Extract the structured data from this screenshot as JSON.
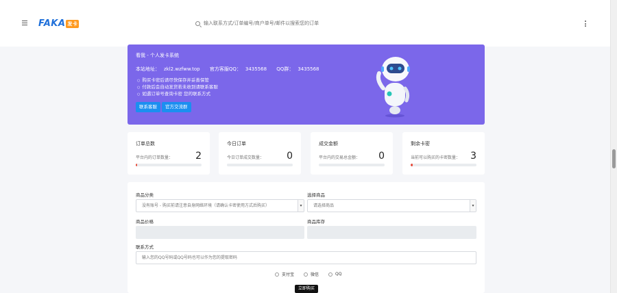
{
  "header": {
    "logo_text": "FAKA",
    "logo_badge": "发卡",
    "search_placeholder": "输入联系方式/订单编号/商户单号/邮件以搜索您的订单"
  },
  "hero": {
    "title": "看我 - 个人发卡系统",
    "site_label": "本站地址：",
    "site_url": "zkl2.wzfww.top",
    "qq_official_label": "官方客服QQ：",
    "qq_official": "3435568",
    "qq_group_label": "QQ群：",
    "qq_group": "3435568",
    "notes": [
      "购买卡密后请尽快保存并妥善保管",
      "付款后会自动发货若未收到请联系客服",
      "如遇订单号查询卡密 您的联系方式"
    ],
    "btn_contact": "联系客服",
    "btn_group": "官方交流群"
  },
  "stats": [
    {
      "label": "订单总数",
      "desc": "平台内的订单数量：",
      "value": "2",
      "progress": 0.02
    },
    {
      "label": "今日订单",
      "desc": "今日订单成交数量：",
      "value": "0",
      "progress": 0
    },
    {
      "label": "成交金额",
      "desc": "平台内的交易总金额：",
      "value": "0",
      "progress": 0
    },
    {
      "label": "剩余卡密",
      "desc": "当前可以购买的卡密数量：",
      "value": "3",
      "progress": 0.03
    }
  ],
  "form": {
    "category_label": "商品分类",
    "category_value": "没有账号 - 购买前请注意自身网络环境（请确认卡密使用方式后购买）",
    "product_label": "选择商品",
    "product_value": "请选择商品",
    "price_label": "商品价格",
    "stock_label": "商品库存",
    "contact_label": "联系方式",
    "contact_placeholder": "输入您的QQ号码或QQ号码也可以作为您的提取密码",
    "payments": [
      "支付宝",
      "微信",
      "QQ"
    ],
    "buy_label": "立即购买"
  },
  "colors": {
    "hero_bg": "#7b67ea",
    "button_blue": "#1b8ff0",
    "progress_red": "#e74c3c"
  }
}
